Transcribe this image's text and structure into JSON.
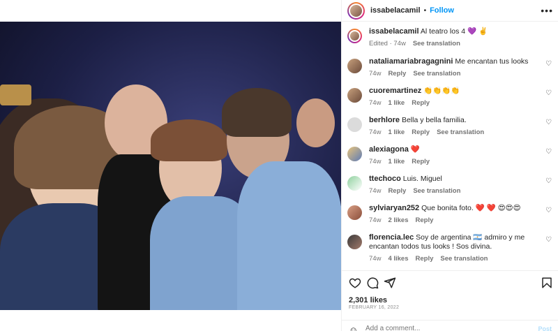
{
  "post": {
    "username": "issabelacamil",
    "follow_label": "Follow",
    "separator": "•",
    "more_label": "•••",
    "caption_user": "issabelacamil",
    "caption_text": "Al teatro los 4 💜 ✌️",
    "caption_meta_edited": "Edited · 74w",
    "caption_meta_translation": "See translation"
  },
  "comments": [
    {
      "user": "nataliamariabragagnini",
      "text": "Me encantan tus looks",
      "time": "74w",
      "likes": "",
      "reply": "Reply",
      "translation": "See translation"
    },
    {
      "user": "cuoremartinez",
      "text": "👏👏👏👏",
      "time": "74w",
      "likes": "1 like",
      "reply": "Reply",
      "translation": ""
    },
    {
      "user": "berhlore",
      "text": "Bella y bella familia.",
      "time": "74w",
      "likes": "1 like",
      "reply": "Reply",
      "translation": "See translation"
    },
    {
      "user": "alexiagona",
      "text": "❤️",
      "time": "74w",
      "likes": "1 like",
      "reply": "Reply",
      "translation": ""
    },
    {
      "user": "ttechoco",
      "text": "Luis. Miguel",
      "time": "74w",
      "likes": "",
      "reply": "Reply",
      "translation": "See translation"
    },
    {
      "user": "sylviaryan252",
      "text": "Que bonita foto. ❤️ ❤️ 😍😍😍",
      "time": "74w",
      "likes": "2 likes",
      "reply": "Reply",
      "translation": ""
    },
    {
      "user": "florencia.lec",
      "text": "Soy de argentina 🇦🇷 admiro y me encantan todos tus looks ! Sos divina.",
      "time": "74w",
      "likes": "4 likes",
      "reply": "Reply",
      "translation": "See translation"
    }
  ],
  "icons": {
    "like": "heart-icon",
    "comment": "comment-icon",
    "share": "share-icon",
    "save": "bookmark-icon",
    "emoji": "emoji-icon"
  },
  "footer": {
    "likes": "2,301 likes",
    "date": "FEBRUARY 16, 2022",
    "add_comment_placeholder": "Add a comment...",
    "post_label": "Post"
  },
  "colors": {
    "accent": "#0095f6",
    "heart_red": "#ed4956",
    "muted": "#737373"
  }
}
